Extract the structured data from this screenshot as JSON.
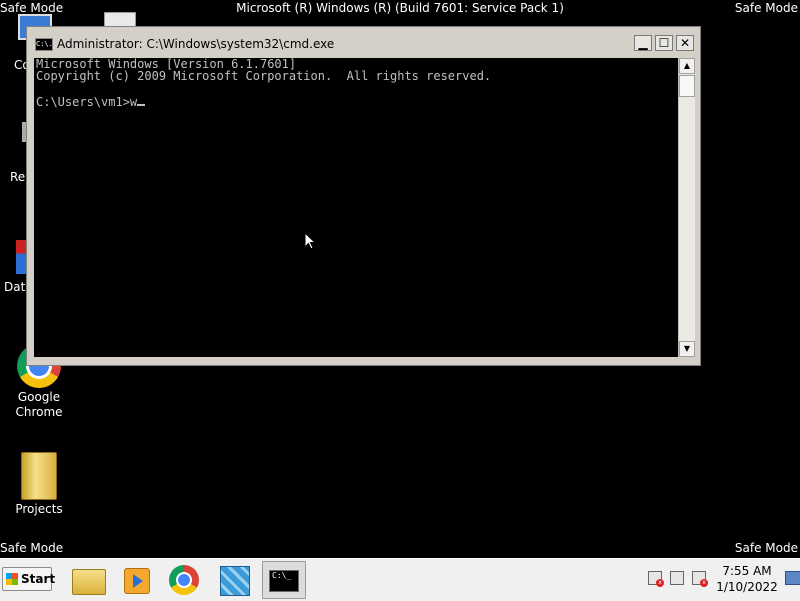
{
  "desktop": {
    "safe_mode_label": "Safe Mode",
    "build_text": "Microsoft (R) Windows (R) (Build 7601: Service Pack 1)",
    "icons": [
      {
        "label": "Co",
        "icon": "computer-icon"
      },
      {
        "label": "Re",
        "icon": "recycle-bin-icon"
      },
      {
        "label": "Data",
        "icon": "shortcut-icon"
      },
      {
        "label_line1": "Google",
        "label_line2": "Chrome",
        "icon": "chrome-icon"
      },
      {
        "label": "Projects",
        "icon": "folder-icon"
      }
    ]
  },
  "window": {
    "title": "Administrator: C:\\Windows\\system32\\cmd.exe",
    "title_icon_text": "C:\\.",
    "buttons": {
      "minimize": "▁",
      "maximize": "☐",
      "close": "✕"
    },
    "console_lines": [
      "Microsoft Windows [Version 6.1.7601]",
      "Copyright (c) 2009 Microsoft Corporation.  All rights reserved.",
      "",
      "C:\\Users\\vm1>w"
    ],
    "scroll_up": "▲",
    "scroll_down": "▼"
  },
  "taskbar": {
    "start_label": "Start",
    "items": [
      "windows-explorer-icon",
      "media-player-icon",
      "chrome-icon",
      "regedit-icon",
      "cmd-icon"
    ],
    "cmd_icon_text": "C:\\_",
    "clock": {
      "time": "7:55 AM",
      "date": "1/10/2022"
    }
  },
  "colors": {
    "desktop_bg": "#000000",
    "console_bg": "#000000",
    "console_text": "#c0c0c0",
    "taskbar_bg": "#f0f0f0"
  }
}
